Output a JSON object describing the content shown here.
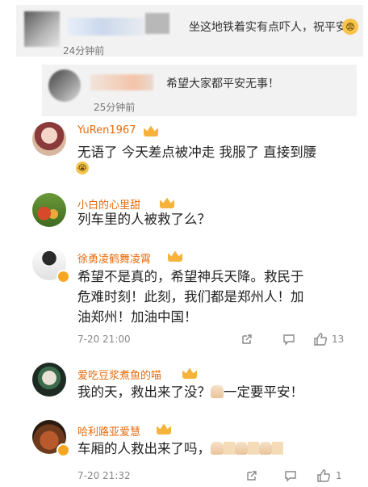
{
  "reply_box": {
    "text": "坐这地铁着实有点吓人，祝平安",
    "time": "24分钟前"
  },
  "nested_reply": {
    "text": "希望大家都平安无事！",
    "time": "25分钟前"
  },
  "comments": [
    {
      "username": "YuRen1967",
      "text": "无语了 今天差点被冲走 我服了 直接到腰"
    },
    {
      "username": "小白的心里甜",
      "text": "列车里的人被救了么？"
    },
    {
      "username": "徐勇凌鹤舞凌霄",
      "text_lines": [
        "希望不是真的，希望神兵天降。救民于",
        "危难时刻！此刻，我们都是郑州人！加",
        "油郑州！加油中国！"
      ],
      "time": "7-20 21:00",
      "likes": "13"
    },
    {
      "username": "爱吃豆浆煮鱼的喵",
      "text_a": "我的天，救出来了没？",
      "text_b": "一定要平安！"
    },
    {
      "username": "哈利路亚爱慧",
      "text": "车厢的人救出来了吗，",
      "time": "7-20 21:32",
      "likes": "1"
    }
  ]
}
